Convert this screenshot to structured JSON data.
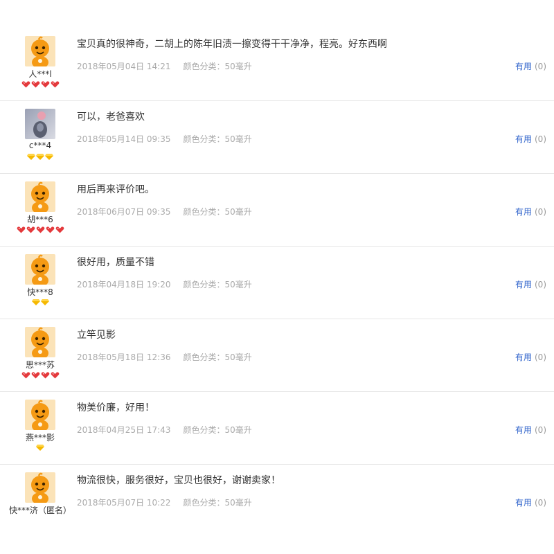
{
  "colors": {
    "link": "#3366cc",
    "meta_text": "#aaaaaa",
    "divider": "#e6e6e6",
    "avatar_orange": "#f59a14",
    "heart_red": "#e4393c",
    "diamond_yellow": "#f5b800"
  },
  "reviews": [
    {
      "user": "人***l",
      "avatar": "orange-mascot",
      "rank_icon": "red-heart",
      "rank_count": 4,
      "content": "宝贝真的很神奇，二胡上的陈年旧渍一擦变得干干净净，程亮。好东西啊",
      "date": "2018年05月04日 14:21",
      "sku": "颜色分类：50毫升",
      "useful_label": "有用",
      "useful_count": "(0)"
    },
    {
      "user": "c***4",
      "avatar": "photo",
      "rank_icon": "yellow-diamond",
      "rank_count": 3,
      "content": "可以，老爸喜欢",
      "date": "2018年05月14日 09:35",
      "sku": "颜色分类：50毫升",
      "useful_label": "有用",
      "useful_count": "(0)"
    },
    {
      "user": "胡***6",
      "avatar": "orange-mascot",
      "rank_icon": "red-heart",
      "rank_count": 5,
      "content": "用后再来评价吧。",
      "date": "2018年06月07日 09:35",
      "sku": "颜色分类：50毫升",
      "useful_label": "有用",
      "useful_count": "(0)"
    },
    {
      "user": "快***8",
      "avatar": "orange-mascot",
      "rank_icon": "yellow-diamond",
      "rank_count": 2,
      "content": "很好用，质量不错",
      "date": "2018年04月18日 19:20",
      "sku": "颜色分类：50毫升",
      "useful_label": "有用",
      "useful_count": "(0)"
    },
    {
      "user": "思***苏",
      "avatar": "orange-mascot",
      "rank_icon": "red-heart",
      "rank_count": 4,
      "content": "立竿见影",
      "date": "2018年05月18日 12:36",
      "sku": "颜色分类：50毫升",
      "useful_label": "有用",
      "useful_count": "(0)"
    },
    {
      "user": "燕***影",
      "avatar": "orange-mascot",
      "rank_icon": "yellow-diamond",
      "rank_count": 1,
      "content": "物美价廉，好用！",
      "date": "2018年04月25日 17:43",
      "sku": "颜色分类：50毫升",
      "useful_label": "有用",
      "useful_count": "(0)"
    },
    {
      "user": "快***济（匿名）",
      "avatar": "orange-mascot",
      "rank_icon": "",
      "rank_count": 0,
      "content": "物流很快，服务很好，宝贝也很好，谢谢卖家！",
      "date": "2018年05月07日 10:22",
      "sku": "颜色分类：50毫升",
      "useful_label": "有用",
      "useful_count": "(0)"
    }
  ]
}
